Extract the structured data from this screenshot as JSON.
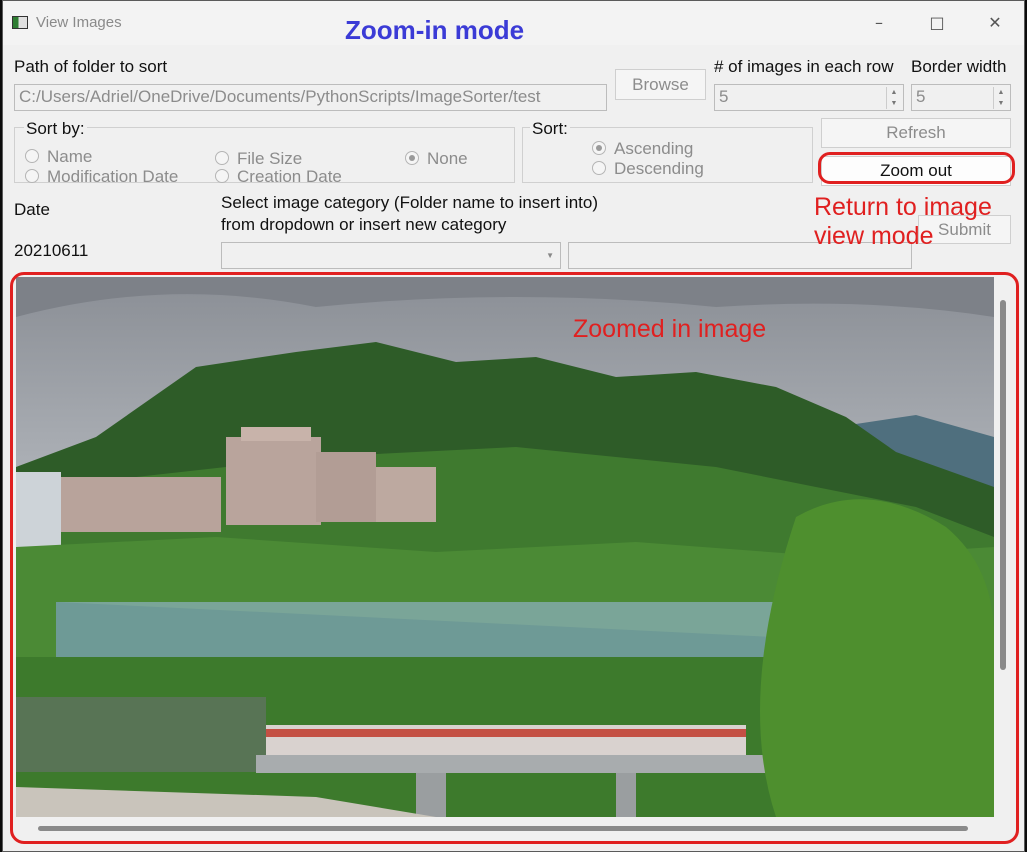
{
  "window": {
    "title": "View Images",
    "minimize_icon": "minimize-icon",
    "maximize_icon": "maximize-icon",
    "close_icon": "close-icon"
  },
  "annotations": {
    "mode": "Zoom-in mode",
    "zoom_out_note": "Return to image view mode",
    "image_note": "Zoomed in image",
    "accent": "#e02020",
    "mode_color": "#3b3bd6"
  },
  "folder": {
    "label": "Path of folder to sort",
    "path": "C:/Users/Adriel/OneDrive/Documents/PythonScripts/ImageSorter/test",
    "browse_label": "Browse"
  },
  "images_per_row": {
    "label": "# of images in each row",
    "value": "5"
  },
  "border_width": {
    "label": "Border width",
    "value": "5"
  },
  "sort_by": {
    "label": "Sort by:",
    "options": [
      "Name",
      "Modification Date",
      "File Size",
      "Creation Date",
      "None"
    ],
    "selected": "None"
  },
  "sort_order": {
    "label": "Sort:",
    "options": [
      "Ascending",
      "Descending"
    ],
    "selected": "Ascending"
  },
  "buttons": {
    "refresh": "Refresh",
    "zoom_out": "Zoom out",
    "submit": "Submit"
  },
  "date": {
    "label": "Date",
    "value": "20210611"
  },
  "category": {
    "label_line1": "Select image category (Folder name to insert into)",
    "label_line2": "from dropdown or insert new category",
    "dropdown_value": "",
    "new_category_value": ""
  }
}
